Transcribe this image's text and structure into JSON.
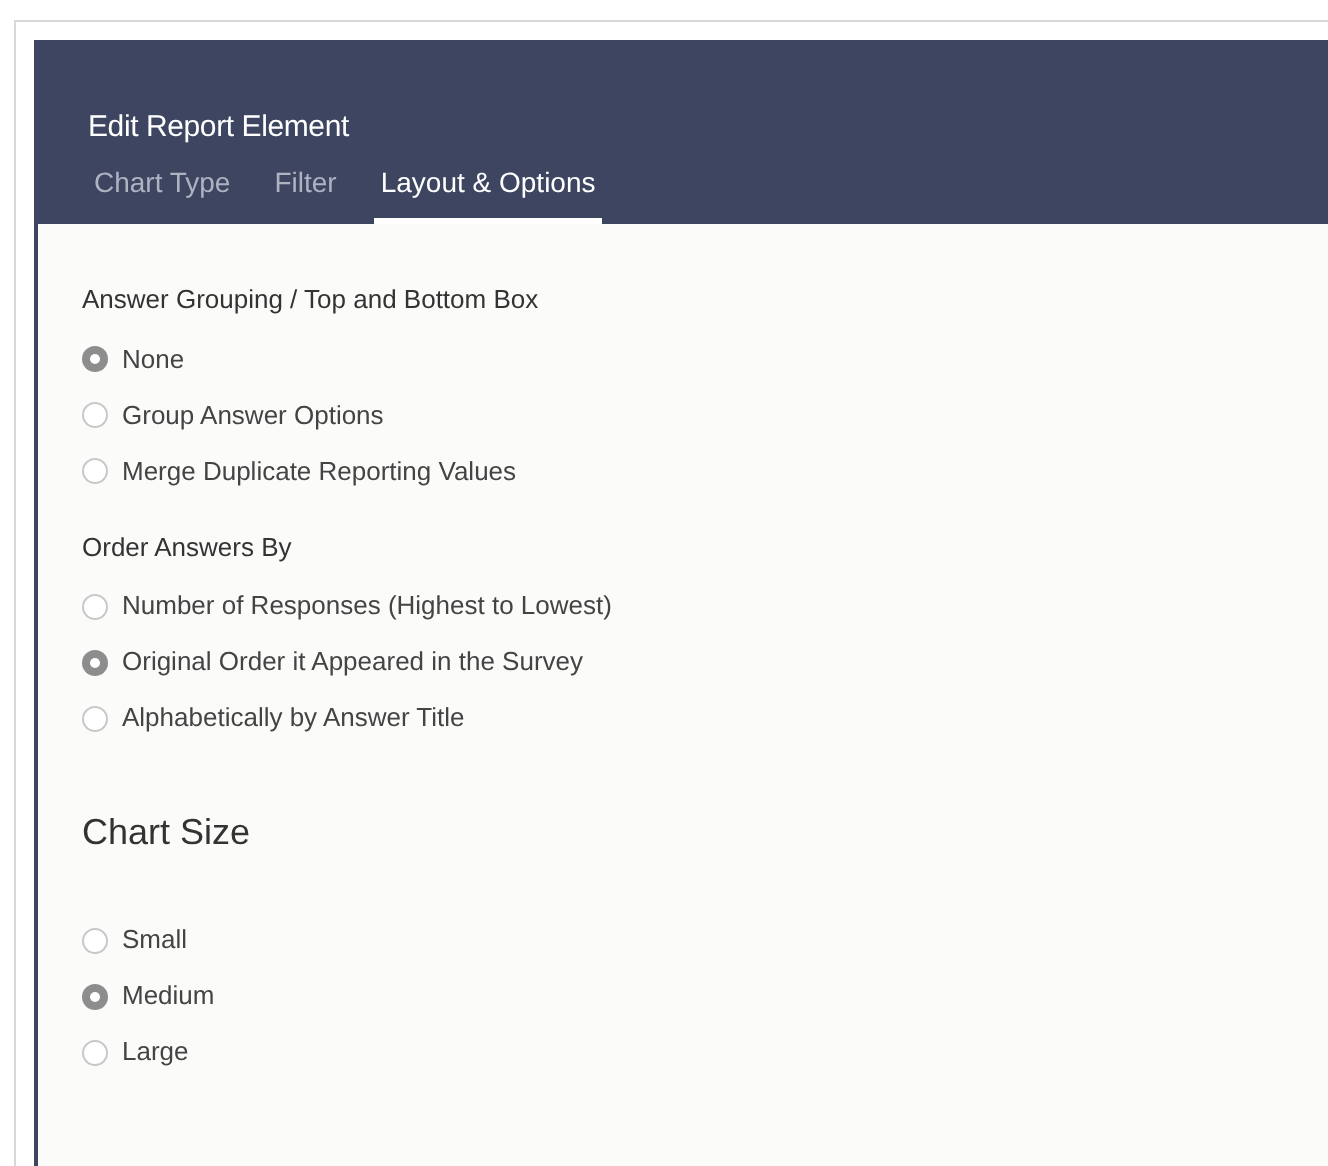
{
  "dialog": {
    "title": "Edit Report Element"
  },
  "tabs": [
    {
      "label": "Chart Type",
      "selected": false
    },
    {
      "label": "Filter",
      "selected": false
    },
    {
      "label": "Layout & Options",
      "selected": true
    }
  ],
  "sections": [
    {
      "kind": "small",
      "heading": "Answer Grouping / Top and Bottom Box",
      "options": [
        {
          "label": "None",
          "selected": true
        },
        {
          "label": "Group Answer Options",
          "selected": false
        },
        {
          "label": "Merge Duplicate Reporting Values",
          "selected": false
        }
      ]
    },
    {
      "kind": "small",
      "heading": "Order Answers By",
      "options": [
        {
          "label": "Number of Responses (Highest to Lowest)",
          "selected": false
        },
        {
          "label": "Original Order it Appeared in the Survey",
          "selected": true
        },
        {
          "label": "Alphabetically by Answer Title",
          "selected": false
        }
      ]
    },
    {
      "kind": "large",
      "heading": "Chart Size",
      "options": [
        {
          "label": "Small",
          "selected": false
        },
        {
          "label": "Medium",
          "selected": true
        },
        {
          "label": "Large",
          "selected": false
        }
      ]
    }
  ]
}
